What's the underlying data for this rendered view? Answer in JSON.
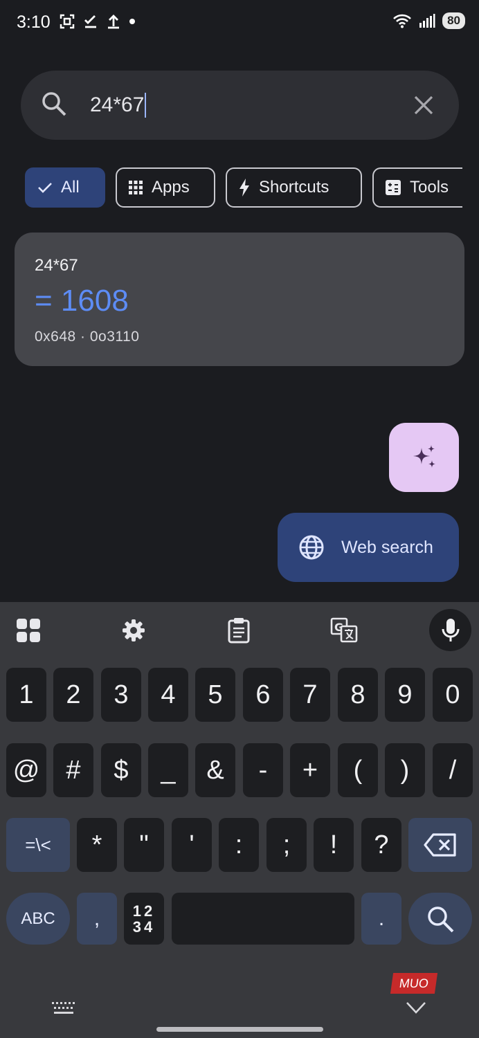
{
  "status_bar": {
    "time": "3:10",
    "battery": "80"
  },
  "search": {
    "query": "24*67"
  },
  "filter_chips": [
    {
      "label": "All",
      "selected": true
    },
    {
      "label": "Apps",
      "selected": false
    },
    {
      "label": "Shortcuts",
      "selected": false
    },
    {
      "label": "Tools",
      "selected": false
    }
  ],
  "calculator_result": {
    "expression": "24*67",
    "value": "= 1608",
    "alt_bases": "0x648 · 0o3110"
  },
  "actions": {
    "web_search_label": "Web search"
  },
  "keyboard": {
    "row1": [
      "1",
      "2",
      "3",
      "4",
      "5",
      "6",
      "7",
      "8",
      "9",
      "0"
    ],
    "row2": [
      "@",
      "#",
      "$",
      "_",
      "&",
      "-",
      "+",
      "(",
      ")",
      "/"
    ],
    "row3_toggle": "=\\<",
    "row3": [
      "*",
      "\"",
      "'",
      ":",
      ";",
      "!",
      "?"
    ],
    "abc_label": "ABC",
    "comma": ",",
    "numpad_label_top": "12",
    "numpad_label_bottom": "34",
    "period": "."
  },
  "watermark": "MUO",
  "colors": {
    "background": "#1b1c20",
    "accent": "#5d8cf5",
    "chip_selected": "#2e4379",
    "fab": "#e5c8f4"
  }
}
